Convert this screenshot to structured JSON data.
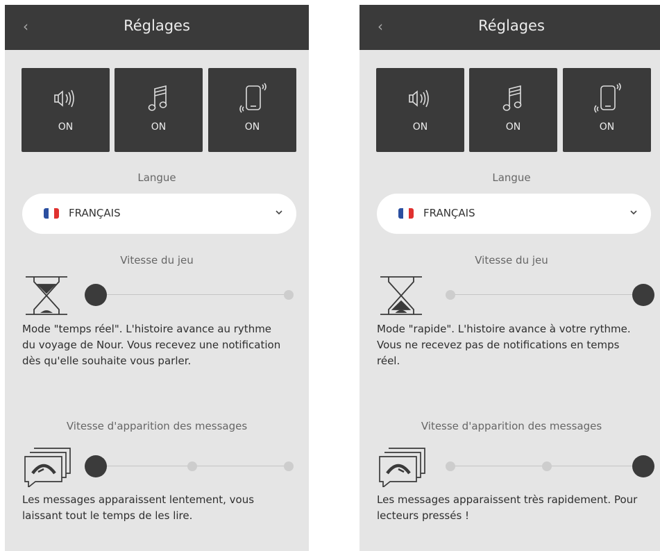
{
  "screens": [
    {
      "header": {
        "title": "Réglages",
        "back_label": "‹"
      },
      "toggles": [
        {
          "icon": "speaker-icon",
          "label": "ON"
        },
        {
          "icon": "music-note-icon",
          "label": "ON"
        },
        {
          "icon": "phone-vibrate-icon",
          "label": "ON"
        }
      ],
      "language": {
        "section_label": "Langue",
        "value": "FRANÇAIS"
      },
      "game_speed": {
        "section_label": "Vitesse du jeu",
        "level": 0,
        "steps": 2,
        "description": "Mode \"temps réel\". L'histoire avance au rythme du voyage de Nour. Vous recevez une notification dès qu'elle souhaite vous parler."
      },
      "message_speed": {
        "section_label": "Vitesse d'apparition des messages",
        "level": 0,
        "steps": 3,
        "description": "Les messages apparaissent lentement, vous laissant tout le temps de les lire."
      }
    },
    {
      "header": {
        "title": "Réglages",
        "back_label": "‹"
      },
      "toggles": [
        {
          "icon": "speaker-icon",
          "label": "ON"
        },
        {
          "icon": "music-note-icon",
          "label": "ON"
        },
        {
          "icon": "phone-vibrate-icon",
          "label": "ON"
        }
      ],
      "language": {
        "section_label": "Langue",
        "value": "FRANÇAIS"
      },
      "game_speed": {
        "section_label": "Vitesse du jeu",
        "level": 1,
        "steps": 2,
        "description": "Mode \"rapide\". L'histoire avance à votre rythme. Vous ne recevez pas de notifications en temps réel."
      },
      "message_speed": {
        "section_label": "Vitesse d'apparition des messages",
        "level": 2,
        "steps": 3,
        "description": "Les messages apparaissent très rapidement. Pour lecteurs pressés !"
      }
    }
  ],
  "colors": {
    "header_bg": "#3a3a3a",
    "screen_bg": "#e5e5e5",
    "knob_active": "#3b3b3b",
    "knob_inactive": "#cdcdcd",
    "flag_blue": "#2b4fa0",
    "flag_white": "#ffffff",
    "flag_red": "#e0312f"
  }
}
